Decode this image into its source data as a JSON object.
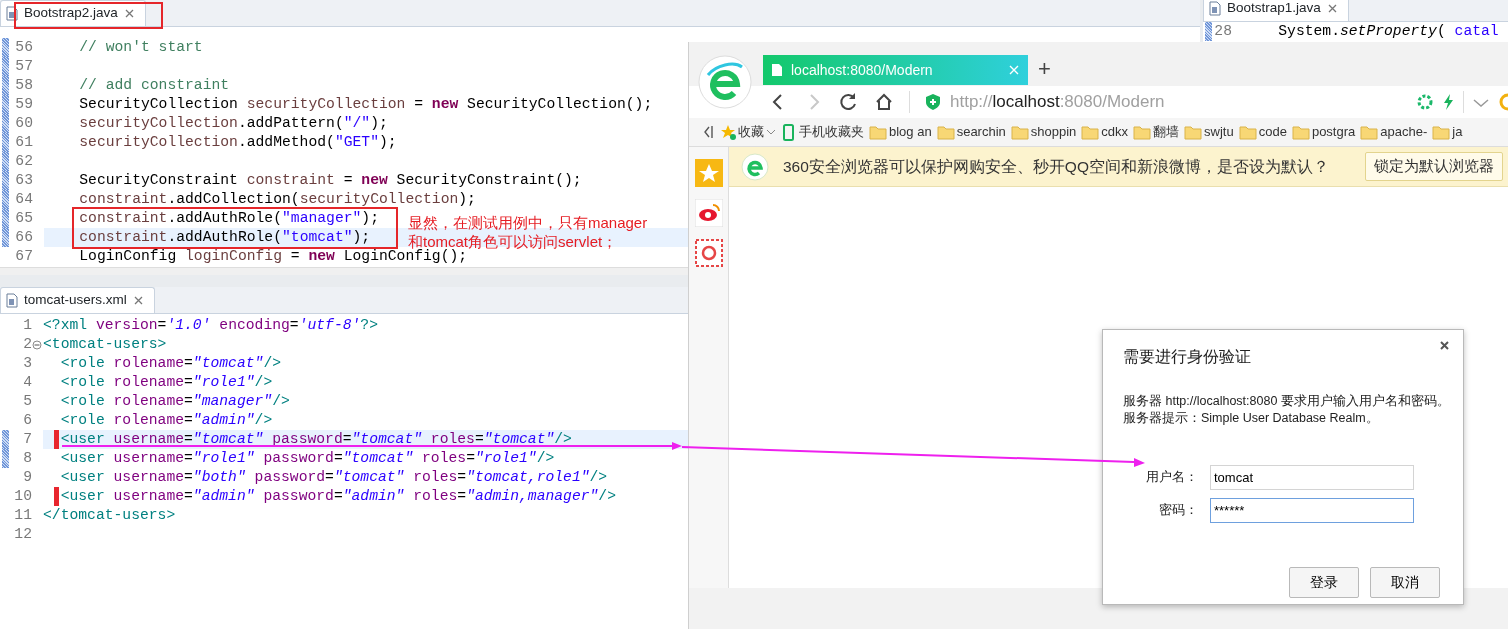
{
  "editors": [
    {
      "tab": {
        "title": "Bootstrap2.java",
        "selected": true
      },
      "lines": [
        {
          "number": "56",
          "changed": true,
          "current": false,
          "segments": [
            {
              "kind": "com",
              "text": "    // won't start"
            }
          ]
        },
        {
          "number": "57",
          "changed": true,
          "current": false
        },
        {
          "number": "58",
          "changed": true,
          "current": false,
          "segments": [
            {
              "kind": "com",
              "text": "    // add constraint"
            }
          ]
        },
        {
          "number": "59",
          "changed": true,
          "current": false,
          "segments": [
            {
              "kind": "p",
              "text": "    SecurityCollection "
            },
            {
              "kind": "var",
              "text": "securityCollection"
            },
            {
              "kind": "p",
              "text": " = "
            },
            {
              "kind": "kw",
              "text": "new"
            },
            {
              "kind": "p",
              "text": " SecurityCollection();"
            }
          ]
        },
        {
          "number": "60",
          "changed": true,
          "current": false,
          "segments": [
            {
              "kind": "var",
              "text": "    securityCollection"
            },
            {
              "kind": "p",
              "text": ".addPattern("
            },
            {
              "kind": "str",
              "text": "\"/\""
            },
            {
              "kind": "p",
              "text": ");"
            }
          ]
        },
        {
          "number": "61",
          "changed": true,
          "current": false,
          "segments": [
            {
              "kind": "var",
              "text": "    securityCollection"
            },
            {
              "kind": "p",
              "text": ".addMethod("
            },
            {
              "kind": "str",
              "text": "\"GET\""
            },
            {
              "kind": "p",
              "text": ");"
            }
          ]
        },
        {
          "number": "62",
          "changed": true,
          "current": false
        },
        {
          "number": "63",
          "changed": true,
          "current": false,
          "segments": [
            {
              "kind": "p",
              "text": "    SecurityConstraint "
            },
            {
              "kind": "var",
              "text": "constraint"
            },
            {
              "kind": "p",
              "text": " = "
            },
            {
              "kind": "kw",
              "text": "new"
            },
            {
              "kind": "p",
              "text": " SecurityConstraint();"
            }
          ]
        },
        {
          "number": "64",
          "changed": true,
          "current": false,
          "segments": [
            {
              "kind": "var",
              "text": "    constraint"
            },
            {
              "kind": "p",
              "text": ".addCollection("
            },
            {
              "kind": "var",
              "text": "securityCollection"
            },
            {
              "kind": "p",
              "text": ");"
            }
          ]
        },
        {
          "number": "65",
          "changed": true,
          "current": false,
          "segments": [
            {
              "kind": "var",
              "text": "    constraint"
            },
            {
              "kind": "p",
              "text": ".addAuthRole("
            },
            {
              "kind": "str",
              "text": "\"manager\""
            },
            {
              "kind": "p",
              "text": ");"
            }
          ]
        },
        {
          "number": "66",
          "changed": true,
          "current": true,
          "segments": [
            {
              "kind": "var",
              "text": "    constraint"
            },
            {
              "kind": "p",
              "text": ".addAuthRole("
            },
            {
              "kind": "str",
              "text": "\"tomcat\""
            },
            {
              "kind": "p",
              "text": ");"
            }
          ]
        },
        {
          "number": "67",
          "changed": false,
          "current": false,
          "segments": [
            {
              "kind": "p",
              "text": "    LoginConfig "
            },
            {
              "kind": "var",
              "text": "loginConfig"
            },
            {
              "kind": "p",
              "text": " = "
            },
            {
              "kind": "kw",
              "text": "new"
            },
            {
              "kind": "p",
              "text": " LoginConfig();"
            }
          ]
        }
      ]
    },
    {
      "tab": {
        "title": "tomcat-users.xml",
        "selected": true
      },
      "lines": [
        {
          "number": "1",
          "changed": false,
          "current": false,
          "marked": false,
          "segments": [
            {
              "kind": "tag",
              "text": "<?xml "
            },
            {
              "kind": "att",
              "text": "version"
            },
            {
              "kind": "p",
              "text": "="
            },
            {
              "kind": "val",
              "text": "'1.0'"
            },
            {
              "kind": "att",
              "text": " encoding"
            },
            {
              "kind": "p",
              "text": "="
            },
            {
              "kind": "val",
              "text": "'utf-8'"
            },
            {
              "kind": "tag",
              "text": "?>"
            }
          ]
        },
        {
          "number": "2",
          "changed": false,
          "current": false,
          "marked": false,
          "expanded": true,
          "segments": [
            {
              "kind": "tag",
              "text": "<tomcat-users>"
            }
          ]
        },
        {
          "number": "3",
          "changed": false,
          "current": false,
          "marked": false,
          "segments": [
            {
              "kind": "tag",
              "text": "  <role "
            },
            {
              "kind": "att",
              "text": "rolename"
            },
            {
              "kind": "p",
              "text": "="
            },
            {
              "kind": "val",
              "text": "\"tomcat\""
            },
            {
              "kind": "tag",
              "text": "/>"
            }
          ]
        },
        {
          "number": "4",
          "changed": false,
          "current": false,
          "marked": false,
          "segments": [
            {
              "kind": "tag",
              "text": "  <role "
            },
            {
              "kind": "att",
              "text": "rolename"
            },
            {
              "kind": "p",
              "text": "="
            },
            {
              "kind": "val",
              "text": "\"role1\""
            },
            {
              "kind": "tag",
              "text": "/>"
            }
          ]
        },
        {
          "number": "5",
          "changed": false,
          "current": false,
          "marked": false,
          "segments": [
            {
              "kind": "tag",
              "text": "  <role "
            },
            {
              "kind": "att",
              "text": "rolename"
            },
            {
              "kind": "p",
              "text": "="
            },
            {
              "kind": "val",
              "text": "\"manager\""
            },
            {
              "kind": "tag",
              "text": "/>"
            }
          ]
        },
        {
          "number": "6",
          "changed": false,
          "current": false,
          "marked": false,
          "segments": [
            {
              "kind": "tag",
              "text": "  <role "
            },
            {
              "kind": "att",
              "text": "rolename"
            },
            {
              "kind": "p",
              "text": "="
            },
            {
              "kind": "val",
              "text": "\"admin\""
            },
            {
              "kind": "tag",
              "text": "/>"
            }
          ]
        },
        {
          "number": "7",
          "changed": true,
          "current": true,
          "marked": true,
          "segments": [
            {
              "kind": "tag",
              "text": "  <user "
            },
            {
              "kind": "att",
              "text": "username"
            },
            {
              "kind": "p",
              "text": "="
            },
            {
              "kind": "val",
              "text": "\"tomcat\""
            },
            {
              "kind": "att",
              "text": " password"
            },
            {
              "kind": "p",
              "text": "="
            },
            {
              "kind": "val",
              "text": "\"tomcat\""
            },
            {
              "kind": "att",
              "text": " roles"
            },
            {
              "kind": "p",
              "text": "="
            },
            {
              "kind": "val",
              "text": "\"tomcat\""
            },
            {
              "kind": "tag",
              "text": "/>"
            }
          ]
        },
        {
          "number": "8",
          "changed": true,
          "current": false,
          "marked": false,
          "segments": [
            {
              "kind": "tag",
              "text": "  <user "
            },
            {
              "kind": "att",
              "text": "username"
            },
            {
              "kind": "p",
              "text": "="
            },
            {
              "kind": "val",
              "text": "\"role1\""
            },
            {
              "kind": "att",
              "text": " password"
            },
            {
              "kind": "p",
              "text": "="
            },
            {
              "kind": "val",
              "text": "\"tomcat\""
            },
            {
              "kind": "att",
              "text": " roles"
            },
            {
              "kind": "p",
              "text": "="
            },
            {
              "kind": "val",
              "text": "\"role1\""
            },
            {
              "kind": "tag",
              "text": "/>"
            }
          ]
        },
        {
          "number": "9",
          "changed": false,
          "current": false,
          "marked": false,
          "segments": [
            {
              "kind": "tag",
              "text": "  <user "
            },
            {
              "kind": "att",
              "text": "username"
            },
            {
              "kind": "p",
              "text": "="
            },
            {
              "kind": "val",
              "text": "\"both\""
            },
            {
              "kind": "att",
              "text": " password"
            },
            {
              "kind": "p",
              "text": "="
            },
            {
              "kind": "val",
              "text": "\"tomcat\""
            },
            {
              "kind": "att",
              "text": " roles"
            },
            {
              "kind": "p",
              "text": "="
            },
            {
              "kind": "val",
              "text": "\"tomcat,role1\""
            },
            {
              "kind": "tag",
              "text": "/>"
            }
          ]
        },
        {
          "number": "10",
          "changed": false,
          "current": false,
          "marked": true,
          "segments": [
            {
              "kind": "tag",
              "text": "  <user "
            },
            {
              "kind": "att",
              "text": "username"
            },
            {
              "kind": "p",
              "text": "="
            },
            {
              "kind": "val",
              "text": "\"admin\""
            },
            {
              "kind": "att",
              "text": " password"
            },
            {
              "kind": "p",
              "text": "="
            },
            {
              "kind": "val",
              "text": "\"admin\""
            },
            {
              "kind": "att",
              "text": " roles"
            },
            {
              "kind": "p",
              "text": "="
            },
            {
              "kind": "val",
              "text": "\"admin,manager\""
            },
            {
              "kind": "tag",
              "text": "/>"
            }
          ]
        },
        {
          "number": "11",
          "changed": false,
          "current": false,
          "marked": false,
          "segments": [
            {
              "kind": "tag",
              "text": "</tomcat-users>"
            }
          ]
        },
        {
          "number": "12",
          "changed": false,
          "current": false,
          "marked": false
        }
      ]
    },
    {
      "tab": {
        "title": "Bootstrap1.java",
        "selected": true
      },
      "lines": [
        {
          "number": "28",
          "changed": true,
          "current": false,
          "segments": [
            {
              "kind": "p",
              "text": "    System."
            },
            {
              "kind": "stat",
              "text": "setProperty"
            },
            {
              "kind": "p",
              "text": "( "
            },
            {
              "kind": "str",
              "text": "catal"
            }
          ]
        }
      ]
    }
  ],
  "annotation": {
    "note": [
      "显然，在测试用例中，只有manager",
      "和tomcat角色可以访问servlet；"
    ]
  },
  "browser": {
    "tabs": [
      {
        "title": "localhost:8080/Modern",
        "selected": true
      }
    ],
    "new_tab": "+",
    "nav": [
      {
        "kind": "back",
        "disabled": false
      },
      {
        "kind": "forward",
        "disabled": true
      },
      {
        "kind": "reload",
        "disabled": false
      },
      {
        "kind": "home",
        "disabled": false
      }
    ],
    "url": {
      "scheme": "http://",
      "host": "localhost",
      "rest": ":8080/Modern"
    },
    "bookmarks": [
      {
        "kind": "favorites",
        "label": "收藏"
      },
      {
        "kind": "mobile",
        "label": "手机收藏夹"
      },
      {
        "kind": "folder",
        "label": "blog an"
      },
      {
        "kind": "folder",
        "label": "searchin"
      },
      {
        "kind": "folder",
        "label": "shoppin"
      },
      {
        "kind": "folder",
        "label": "cdkx"
      },
      {
        "kind": "folder",
        "label": "翻墙"
      },
      {
        "kind": "folder",
        "label": "swjtu"
      },
      {
        "kind": "folder",
        "label": "code"
      },
      {
        "kind": "folder",
        "label": "postgra"
      },
      {
        "kind": "folder",
        "label": "apache-"
      },
      {
        "kind": "folder",
        "label": "ja"
      }
    ],
    "sidebar": [
      {
        "kind": "favorites"
      },
      {
        "kind": "weibo"
      },
      {
        "kind": "mail"
      }
    ],
    "notification": {
      "message": "360安全浏览器可以保护网购安全、秒开QQ空间和新浪微博，是否设为默认？",
      "button": "锁定为默认浏览器"
    }
  },
  "dialog": {
    "title": "需要进行身份验证",
    "message": [
      "服务器 http://localhost:8080 要求用户输入用户名和密码。",
      "服务器提示：Simple User Database Realm。"
    ],
    "fields": [
      {
        "label": "用户名：",
        "value": "tomcat",
        "focused": false
      },
      {
        "label": "密码：",
        "value": "******",
        "focused": true
      }
    ],
    "buttons": [
      "登录",
      "取消"
    ]
  }
}
